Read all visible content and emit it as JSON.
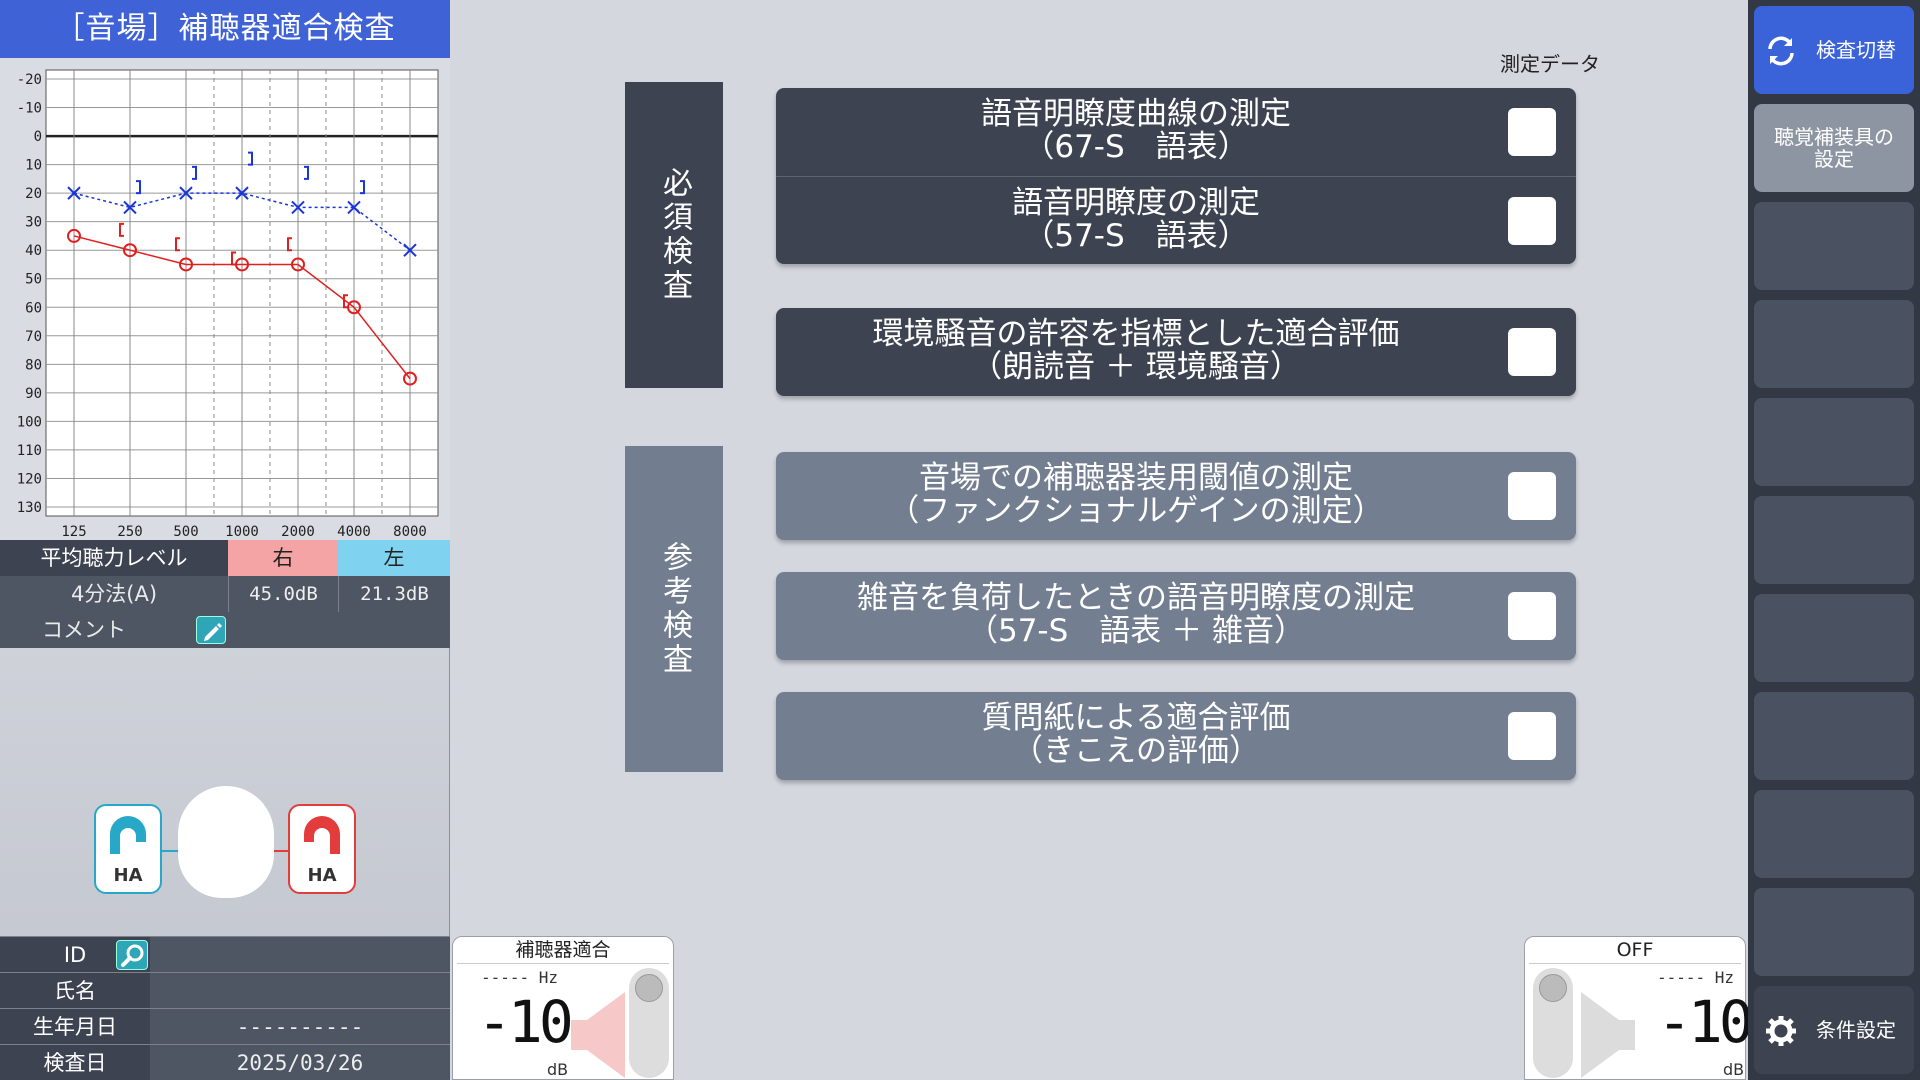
{
  "header": {
    "title": "［音場］補聴器適合検査"
  },
  "chart_data": {
    "type": "line",
    "x": [
      "125",
      "250",
      "500",
      "1000",
      "2000",
      "4000",
      "8000"
    ],
    "ylim": [
      -20,
      130
    ],
    "y_reversed": true,
    "yticks": [
      -20,
      -10,
      0,
      10,
      20,
      30,
      40,
      50,
      60,
      70,
      80,
      90,
      100,
      110,
      120,
      130
    ],
    "grid": true,
    "series": [
      {
        "name": "",
        "color": "#e02020",
        "marker": "circle",
        "dash": "solid",
        "values": [
          35,
          40,
          45,
          45,
          45,
          60,
          85
        ]
      },
      {
        "name": "",
        "color": "#1a36d8",
        "marker": "x",
        "dash": "dotted",
        "values": [
          20,
          25,
          20,
          20,
          25,
          25,
          40
        ]
      },
      {
        "name": "",
        "color": "#e02020",
        "marker": "bracket-left",
        "x_index": [
          1,
          2,
          3,
          4,
          5
        ],
        "values": [
          35,
          40,
          45,
          40,
          60
        ]
      },
      {
        "name": "",
        "color": "#1a36d8",
        "marker": "bracket-right",
        "x_index": [
          1,
          2,
          3,
          4,
          5
        ],
        "values": [
          20,
          15,
          10,
          15,
          20
        ]
      }
    ],
    "xlabel": "",
    "ylabel": "",
    "title": ""
  },
  "average": {
    "header_label": "平均聴力レベル",
    "right_label": "右",
    "left_label": "左",
    "method_label": "4分法(A)",
    "right_value": "45.0dB",
    "left_value": "21.3dB",
    "comment_label": "コメント"
  },
  "ears": {
    "left_label": "HA",
    "right_label": "HA"
  },
  "patient": {
    "id_label": "ID",
    "id_value": "",
    "name_label": "氏名",
    "name_value": "",
    "birth_label": "生年月日",
    "birth_value": "----------",
    "date_label": "検査日",
    "date_value": "2025/03/26"
  },
  "main": {
    "data_label": "測定データ",
    "required_label": "必須検査",
    "reference_label": "参考検査",
    "tests": [
      {
        "line1": "語音明瞭度曲線の測定",
        "line2": "（67-S　語表）"
      },
      {
        "line1": "語音明瞭度の測定",
        "line2": "（57-S　語表）"
      },
      {
        "line1": "環境騒音の許容を指標とした適合評価",
        "line2": "（朗読音 ＋ 環境騒音）"
      },
      {
        "line1": "音場での補聴器装用閾値の測定",
        "line2": "（ファンクショナルゲインの測定）"
      },
      {
        "line1": "雑音を負荷したときの語音明瞭度の測定",
        "line2": "（57-S　語表 ＋ 雑音）"
      },
      {
        "line1": "質問紙による適合評価",
        "line2": "（きこえの評価）"
      }
    ]
  },
  "bottom": {
    "left_title": "補聴器適合",
    "left_hz": "----- Hz",
    "left_db": "-10",
    "left_unit": "dB",
    "right_title": "OFF",
    "right_hz": "----- Hz",
    "right_db": "-10",
    "right_unit": "dB"
  },
  "sidebar": {
    "switch_label": "検査切替",
    "device_label": "聴覚補装具の設定",
    "settings_label": "条件設定",
    "accent": "#3b63d9"
  }
}
